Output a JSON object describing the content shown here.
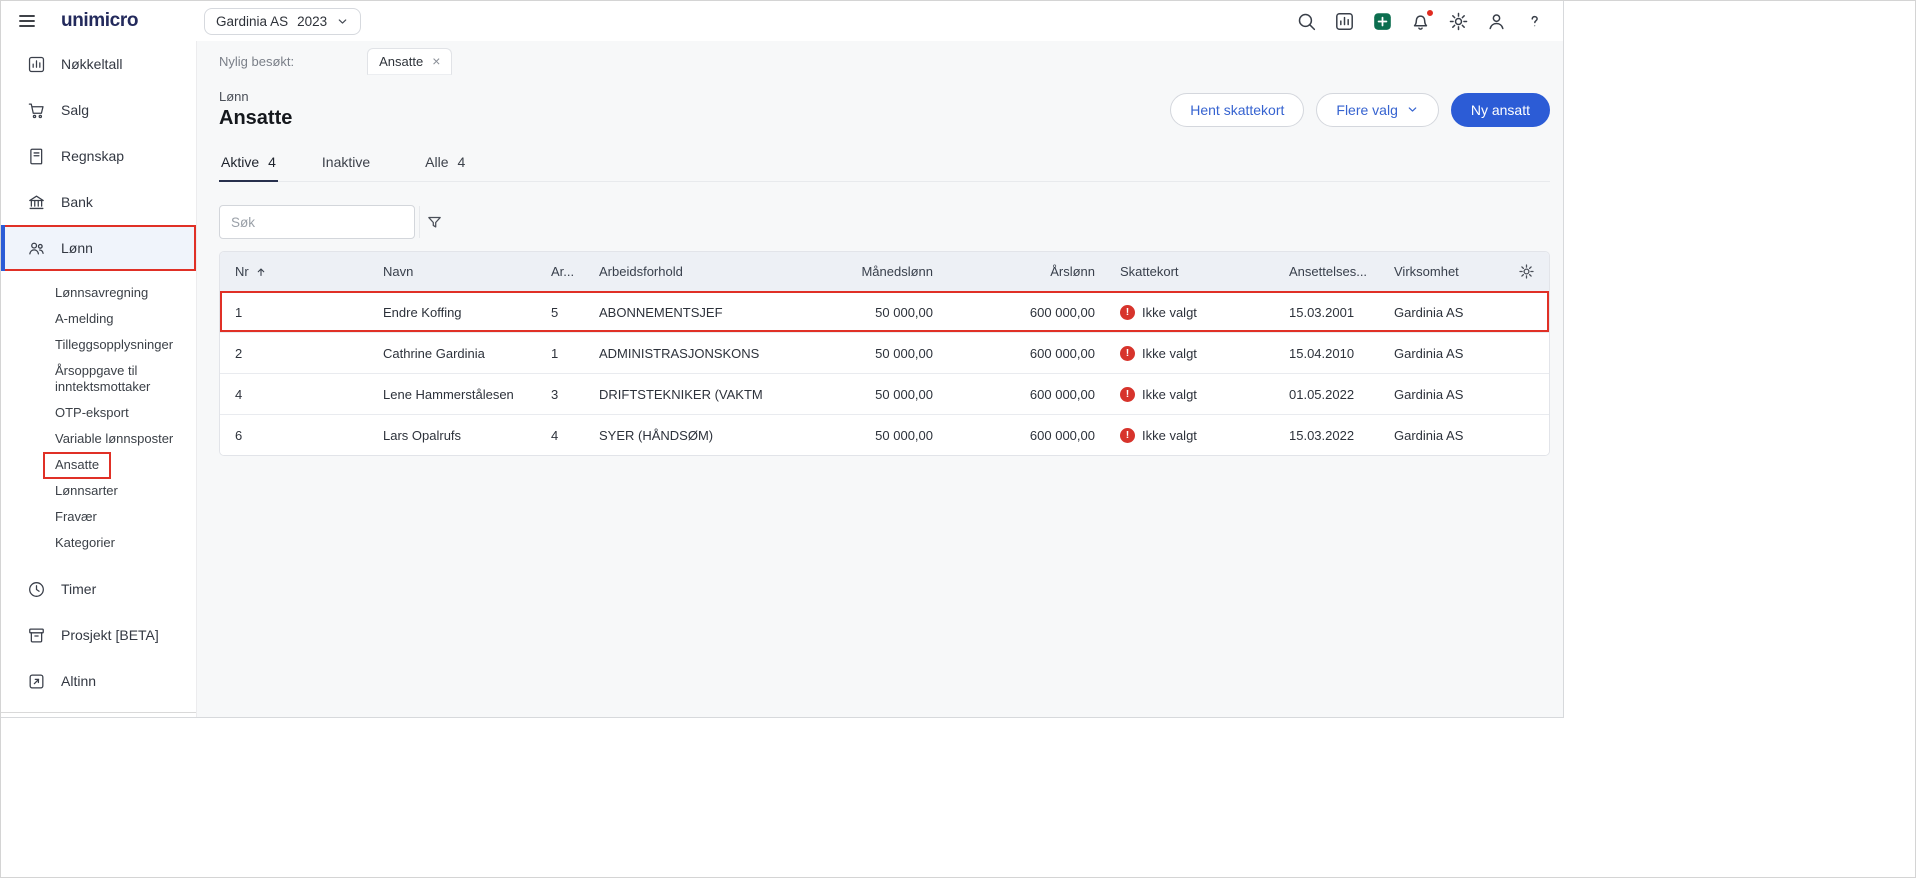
{
  "topbar": {
    "logo": "unimicro",
    "company": "Gardinia AS",
    "year": "2023"
  },
  "sidebar": {
    "items": [
      {
        "label": "Nøkkeltall"
      },
      {
        "label": "Salg"
      },
      {
        "label": "Regnskap"
      },
      {
        "label": "Bank"
      },
      {
        "label": "Lønn"
      },
      {
        "label": "Timer"
      },
      {
        "label": "Prosjekt [BETA]"
      },
      {
        "label": "Altinn"
      }
    ],
    "lonn_subitems": [
      "Lønnsavregning",
      "A-melding",
      "Tilleggsopplysninger",
      "Årsoppgave til inntektsmottaker",
      "OTP-eksport",
      "Variable lønnsposter",
      "Ansatte",
      "Lønnsarter",
      "Fravær",
      "Kategorier"
    ]
  },
  "recent": {
    "label": "Nylig besøkt:",
    "tab": "Ansatte"
  },
  "header": {
    "breadcrumb": "Lønn",
    "title": "Ansatte",
    "buttons": {
      "hent": "Hent skattekort",
      "flere": "Flere valg",
      "ny": "Ny ansatt"
    }
  },
  "tabs": [
    {
      "label": "Aktive",
      "count": "4"
    },
    {
      "label": "Inaktive",
      "count": ""
    },
    {
      "label": "Alle",
      "count": "4"
    }
  ],
  "search": {
    "placeholder": "Søk"
  },
  "table": {
    "columns": {
      "nr": "Nr",
      "navn": "Navn",
      "ar": "Ar...",
      "arbeidsforhold": "Arbeidsforhold",
      "manedslonn": "Månedslønn",
      "arslonn": "Årslønn",
      "skattekort": "Skattekort",
      "ansettelses": "Ansettelses...",
      "virksomhet": "Virksomhet"
    },
    "rows": [
      {
        "nr": "1",
        "navn": "Endre Koffing",
        "ar": "5",
        "arbeidsforhold": "ABONNEMENTSJEF",
        "manedslonn": "50 000,00",
        "arslonn": "600 000,00",
        "skattekort": "Ikke valgt",
        "ansettelsesdato": "15.03.2001",
        "virksomhet": "Gardinia AS"
      },
      {
        "nr": "2",
        "navn": "Cathrine Gardinia",
        "ar": "1",
        "arbeidsforhold": "ADMINISTRASJONSKONS",
        "manedslonn": "50 000,00",
        "arslonn": "600 000,00",
        "skattekort": "Ikke valgt",
        "ansettelsesdato": "15.04.2010",
        "virksomhet": "Gardinia AS"
      },
      {
        "nr": "4",
        "navn": "Lene Hammerstålesen",
        "ar": "3",
        "arbeidsforhold": "DRIFTSTEKNIKER (VAKTM",
        "manedslonn": "50 000,00",
        "arslonn": "600 000,00",
        "skattekort": "Ikke valgt",
        "ansettelsesdato": "01.05.2022",
        "virksomhet": "Gardinia AS"
      },
      {
        "nr": "6",
        "navn": "Lars Opalrufs",
        "ar": "4",
        "arbeidsforhold": "SYER (HÅNDSØM)",
        "manedslonn": "50 000,00",
        "arslonn": "600 000,00",
        "skattekort": "Ikke valgt",
        "ansettelsesdato": "15.03.2022",
        "virksomhet": "Gardinia AS"
      }
    ]
  },
  "icons": {
    "alert": "!",
    "close": "×"
  },
  "colors": {
    "primary": "#2c5cd6",
    "annotation": "#e03026",
    "alert": "#d7342c"
  }
}
